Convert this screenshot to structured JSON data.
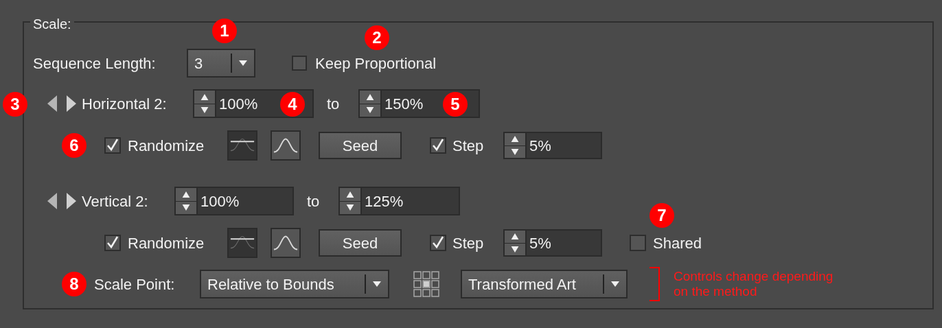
{
  "group": {
    "title": "Scale:"
  },
  "sequence_length": {
    "label": "Sequence Length:",
    "value": "3"
  },
  "keep_proportional": {
    "label": "Keep Proportional",
    "checked": false
  },
  "axes": [
    {
      "label": "Horizontal 2:",
      "from": "100%",
      "to_label": "to",
      "to": "150%",
      "randomize": {
        "label": "Randomize",
        "checked": true
      },
      "distributions": [
        {
          "kind": "flat",
          "selected": true
        },
        {
          "kind": "bell",
          "selected": false
        }
      ],
      "seed": "Seed",
      "step": {
        "label": "Step",
        "checked": true,
        "value": "5%"
      }
    },
    {
      "label": "Vertical 2:",
      "from": "100%",
      "to_label": "to",
      "to": "125%",
      "randomize": {
        "label": "Randomize",
        "checked": true
      },
      "distributions": [
        {
          "kind": "flat",
          "selected": true
        },
        {
          "kind": "bell",
          "selected": false
        }
      ],
      "seed": "Seed",
      "step": {
        "label": "Step",
        "checked": true,
        "value": "5%"
      },
      "shared": {
        "label": "Shared",
        "checked": false
      }
    }
  ],
  "scale_point": {
    "label": "Scale Point:",
    "value": "Relative to Bounds"
  },
  "transform_target": {
    "value": "Transformed Art"
  },
  "note": {
    "lines": [
      "Controls change depending",
      "on the method"
    ]
  },
  "callouts": [
    {
      "label": "1"
    },
    {
      "label": "2"
    },
    {
      "label": "3"
    },
    {
      "label": "4"
    },
    {
      "label": "5"
    },
    {
      "label": "6"
    },
    {
      "label": "7"
    },
    {
      "label": "8"
    }
  ]
}
